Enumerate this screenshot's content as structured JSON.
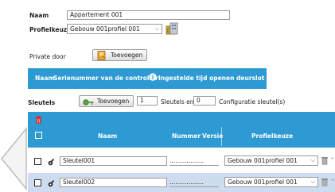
{
  "form": {
    "naam_label": "Naam",
    "naam_value": "Appartement    001",
    "profielkeuze_label": "Profielkeuze",
    "profielkeuze_value": "Gebouw 001profiel 001"
  },
  "private_door": {
    "label": "Private door",
    "add_button": "Toevoegen",
    "header": {
      "naam": "Naam",
      "serienummer": "Serienummer van de controller",
      "info_icon": "info-icon",
      "ingestelde_tijd": "Ingestelde tijd openen deurslot (s)"
    }
  },
  "sleutels": {
    "label": "Sleutels",
    "add_button": "Toevoegen",
    "count1": "1",
    "text_en": "Sleutels  en",
    "count2": "0",
    "text_config": "Configuratie sleutel(s)",
    "columns": {
      "naam": "Naam",
      "nummer": "Nummer",
      "versie": "Versie",
      "profielkeuze": "Profielkeuze"
    },
    "rows": [
      {
        "name": "Sleutel001",
        "nummer": "..................",
        "versie": "..",
        "profile": "Gebouw 001profiel 001"
      },
      {
        "name": "Sleutel002",
        "nummer": "..................",
        "versie": "..",
        "profile": "Gebouw 001profiel 001"
      }
    ]
  },
  "colors": {
    "accent_blue": "#2e9ad3",
    "row_alt": "#cddcf0",
    "trash_red": "#d9312b"
  }
}
